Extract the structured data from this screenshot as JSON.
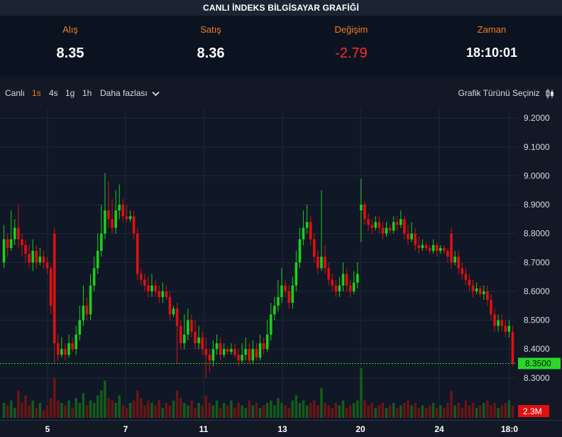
{
  "title": "CANLI İNDEKS BİLGİSAYAR GRAFİĞİ",
  "quotes": {
    "bid": {
      "label": "Alış",
      "value": "8.35"
    },
    "ask": {
      "label": "Satış",
      "value": "8.36"
    },
    "change": {
      "label": "Değişim",
      "value": "-2.79"
    },
    "time": {
      "label": "Zaman",
      "value": "18:10:01"
    }
  },
  "toolbar": {
    "live": "Canlı",
    "intervals": [
      "1s",
      "4s",
      "1g",
      "1h"
    ],
    "active_interval": "1s",
    "more": "Daha fazlası",
    "chart_type": "Grafik Türünü Seçiniz"
  },
  "colors": {
    "up": "#19d219",
    "down": "#e01010",
    "vol_up": "#145c1a",
    "vol_down": "#6a1515",
    "accent": "#f07f1c",
    "last_price": "#2bd62b"
  },
  "chart_data": {
    "type": "candlestick",
    "ylim": [
      8.27,
      9.23
    ],
    "y_ticks": [
      "9.2000",
      "9.1000",
      "9.0000",
      "8.9000",
      "8.8000",
      "8.7000",
      "8.6000",
      "8.5000",
      "8.4000",
      "8.3000"
    ],
    "y_tick_values": [
      9.2,
      9.1,
      9.0,
      8.9,
      8.8,
      8.7,
      8.6,
      8.5,
      8.4,
      8.3
    ],
    "x_ticks": [
      "5",
      "7",
      "11",
      "13",
      "20",
      "24",
      "18:0"
    ],
    "last_price": 8.35,
    "last_price_label": "8.3500",
    "volume_label": "2.3M",
    "candles": [
      [
        8.7,
        8.78,
        8.83,
        8.68
      ],
      [
        8.78,
        8.75,
        8.8,
        8.72
      ],
      [
        8.75,
        8.78,
        8.88,
        8.74
      ],
      [
        8.78,
        8.82,
        8.85,
        8.76
      ],
      [
        8.82,
        8.78,
        8.9,
        8.75
      ],
      [
        8.78,
        8.76,
        8.8,
        8.72
      ],
      [
        8.76,
        8.73,
        8.78,
        8.7
      ],
      [
        8.73,
        8.7,
        8.76,
        8.68
      ],
      [
        8.7,
        8.74,
        8.78,
        8.67
      ],
      [
        8.74,
        8.7,
        8.76,
        8.68
      ],
      [
        8.7,
        8.72,
        8.75,
        8.69
      ],
      [
        8.72,
        8.7,
        8.74,
        8.68
      ],
      [
        8.7,
        8.68,
        8.72,
        8.66
      ],
      [
        8.68,
        8.55,
        8.69,
        8.52
      ],
      [
        8.8,
        8.42,
        8.82,
        8.35
      ],
      [
        8.42,
        8.38,
        8.45,
        8.36
      ],
      [
        8.38,
        8.4,
        8.44,
        8.37
      ],
      [
        8.4,
        8.38,
        8.42,
        8.36
      ],
      [
        8.38,
        8.42,
        8.45,
        8.37
      ],
      [
        8.42,
        8.4,
        8.44,
        8.39
      ],
      [
        8.4,
        8.45,
        8.48,
        8.38
      ],
      [
        8.45,
        8.5,
        8.55,
        8.43
      ],
      [
        8.5,
        8.55,
        8.62,
        8.48
      ],
      [
        8.55,
        8.52,
        8.58,
        8.5
      ],
      [
        8.52,
        8.62,
        8.66,
        8.5
      ],
      [
        8.62,
        8.68,
        8.72,
        8.6
      ],
      [
        8.68,
        8.74,
        8.8,
        8.66
      ],
      [
        8.74,
        8.8,
        8.9,
        8.72
      ],
      [
        8.8,
        8.88,
        9.01,
        8.78
      ],
      [
        8.88,
        8.85,
        8.98,
        8.82
      ],
      [
        8.85,
        8.82,
        8.92,
        8.8
      ],
      [
        8.82,
        8.88,
        8.95,
        8.8
      ],
      [
        8.88,
        8.9,
        8.97,
        8.85
      ],
      [
        8.9,
        8.86,
        8.92,
        8.84
      ],
      [
        8.86,
        8.85,
        8.9,
        8.84
      ],
      [
        8.85,
        8.86,
        8.88,
        8.84
      ],
      [
        8.86,
        8.8,
        8.88,
        8.78
      ],
      [
        8.8,
        8.66,
        8.82,
        8.64
      ],
      [
        8.66,
        8.64,
        8.68,
        8.62
      ],
      [
        8.64,
        8.62,
        8.66,
        8.6
      ],
      [
        8.62,
        8.6,
        8.65,
        8.58
      ],
      [
        8.6,
        8.62,
        8.66,
        8.58
      ],
      [
        8.62,
        8.6,
        8.64,
        8.58
      ],
      [
        8.6,
        8.58,
        8.62,
        8.56
      ],
      [
        8.58,
        8.6,
        8.63,
        8.56
      ],
      [
        8.6,
        8.58,
        8.62,
        8.57
      ],
      [
        8.58,
        8.52,
        8.6,
        8.5
      ],
      [
        8.52,
        8.54,
        8.55,
        8.51
      ],
      [
        8.54,
        8.48,
        8.56,
        8.35
      ],
      [
        8.48,
        8.42,
        8.5,
        8.4
      ],
      [
        8.42,
        8.45,
        8.52,
        8.4
      ],
      [
        8.45,
        8.5,
        8.54,
        8.43
      ],
      [
        8.5,
        8.46,
        8.52,
        8.44
      ],
      [
        8.46,
        8.42,
        8.5,
        8.4
      ],
      [
        8.42,
        8.44,
        8.48,
        8.4
      ],
      [
        8.44,
        8.4,
        8.46,
        8.38
      ],
      [
        8.4,
        8.38,
        8.44,
        8.3
      ],
      [
        8.38,
        8.36,
        8.4,
        8.32
      ],
      [
        8.36,
        8.4,
        8.43,
        8.34
      ],
      [
        8.4,
        8.42,
        8.45,
        8.38
      ],
      [
        8.42,
        8.38,
        8.44,
        8.36
      ],
      [
        8.38,
        8.4,
        8.42,
        8.37
      ],
      [
        8.4,
        8.39,
        8.41,
        8.38
      ],
      [
        8.39,
        8.4,
        8.42,
        8.38
      ],
      [
        8.4,
        8.38,
        8.42,
        8.37
      ],
      [
        8.38,
        8.36,
        8.4,
        8.34
      ],
      [
        8.36,
        8.38,
        8.42,
        8.35
      ],
      [
        8.38,
        8.4,
        8.44,
        8.36
      ],
      [
        8.4,
        8.36,
        8.42,
        8.35
      ],
      [
        8.36,
        8.4,
        8.43,
        8.35
      ],
      [
        8.4,
        8.37,
        8.42,
        8.36
      ],
      [
        8.37,
        8.42,
        8.45,
        8.36
      ],
      [
        8.42,
        8.4,
        8.44,
        8.38
      ],
      [
        8.4,
        8.45,
        8.5,
        8.39
      ],
      [
        8.45,
        8.52,
        8.56,
        8.43
      ],
      [
        8.52,
        8.55,
        8.58,
        8.5
      ],
      [
        8.55,
        8.58,
        8.64,
        8.53
      ],
      [
        8.58,
        8.62,
        8.68,
        8.56
      ],
      [
        8.62,
        8.6,
        8.64,
        8.58
      ],
      [
        8.6,
        8.56,
        8.62,
        8.54
      ],
      [
        8.56,
        8.62,
        8.65,
        8.54
      ],
      [
        8.62,
        8.7,
        8.74,
        8.6
      ],
      [
        8.7,
        8.78,
        8.82,
        8.68
      ],
      [
        8.78,
        8.82,
        8.88,
        8.76
      ],
      [
        8.82,
        8.84,
        8.9,
        8.8
      ],
      [
        8.84,
        8.78,
        8.86,
        8.76
      ],
      [
        8.78,
        8.72,
        8.8,
        8.7
      ],
      [
        8.72,
        8.68,
        8.74,
        8.66
      ],
      [
        8.68,
        8.72,
        8.95,
        8.67
      ],
      [
        8.72,
        8.68,
        8.76,
        8.66
      ],
      [
        8.68,
        8.64,
        8.7,
        8.62
      ],
      [
        8.64,
        8.62,
        8.66,
        8.6
      ],
      [
        8.62,
        8.6,
        8.64,
        8.58
      ],
      [
        8.6,
        8.62,
        8.65,
        8.58
      ],
      [
        8.62,
        8.66,
        8.7,
        8.6
      ],
      [
        8.66,
        8.62,
        8.68,
        8.6
      ],
      [
        8.62,
        8.6,
        8.64,
        8.58
      ],
      [
        8.6,
        8.63,
        8.67,
        8.59
      ],
      [
        8.63,
        8.66,
        8.7,
        8.61
      ],
      [
        8.88,
        8.9,
        8.99,
        8.77
      ],
      [
        8.9,
        8.85,
        8.91,
        8.83
      ],
      [
        8.85,
        8.83,
        8.87,
        8.81
      ],
      [
        8.83,
        8.82,
        8.85,
        8.8
      ],
      [
        8.82,
        8.84,
        8.86,
        8.81
      ],
      [
        8.84,
        8.82,
        8.86,
        8.8
      ],
      [
        8.82,
        8.8,
        8.84,
        8.78
      ],
      [
        8.8,
        8.82,
        8.84,
        8.79
      ],
      [
        8.82,
        8.81,
        8.83,
        8.8
      ],
      [
        8.81,
        8.84,
        8.86,
        8.8
      ],
      [
        8.84,
        8.83,
        8.86,
        8.81
      ],
      [
        8.83,
        8.85,
        8.88,
        8.82
      ],
      [
        8.85,
        8.8,
        8.86,
        8.78
      ],
      [
        8.8,
        8.78,
        8.83,
        8.76
      ],
      [
        8.78,
        8.8,
        8.84,
        8.77
      ],
      [
        8.8,
        8.76,
        8.82,
        8.74
      ],
      [
        8.76,
        8.75,
        8.79,
        8.73
      ],
      [
        8.75,
        8.76,
        8.78,
        8.74
      ],
      [
        8.76,
        8.75,
        8.77,
        8.74
      ],
      [
        8.75,
        8.74,
        8.76,
        8.73
      ],
      [
        8.74,
        8.76,
        8.78,
        8.73
      ],
      [
        8.76,
        8.74,
        8.77,
        8.72
      ],
      [
        8.74,
        8.75,
        8.76,
        8.73
      ],
      [
        8.75,
        8.74,
        8.76,
        8.73
      ],
      [
        8.74,
        8.72,
        8.75,
        8.7
      ],
      [
        8.8,
        8.7,
        8.82,
        8.68
      ],
      [
        8.7,
        8.72,
        8.74,
        8.69
      ],
      [
        8.72,
        8.68,
        8.74,
        8.66
      ],
      [
        8.68,
        8.66,
        8.7,
        8.64
      ],
      [
        8.66,
        8.64,
        8.68,
        8.62
      ],
      [
        8.64,
        8.62,
        8.66,
        8.6
      ],
      [
        8.62,
        8.6,
        8.64,
        8.58
      ],
      [
        8.6,
        8.61,
        8.63,
        8.59
      ],
      [
        8.61,
        8.59,
        8.62,
        8.58
      ],
      [
        8.59,
        8.6,
        8.62,
        8.57
      ],
      [
        8.6,
        8.57,
        8.62,
        8.55
      ],
      [
        8.57,
        8.52,
        8.59,
        8.5
      ],
      [
        8.52,
        8.48,
        8.54,
        8.46
      ],
      [
        8.48,
        8.5,
        8.52,
        8.46
      ],
      [
        8.5,
        8.48,
        8.52,
        8.46
      ],
      [
        8.48,
        8.46,
        8.5,
        8.44
      ],
      [
        8.46,
        8.48,
        8.5,
        8.44
      ],
      [
        8.46,
        8.35,
        8.48,
        8.34
      ]
    ],
    "volumes": [
      0.3,
      0.25,
      0.35,
      0.2,
      0.55,
      0.3,
      0.45,
      0.25,
      0.35,
      0.2,
      0.3,
      0.15,
      0.25,
      0.4,
      0.8,
      0.35,
      0.3,
      0.25,
      0.35,
      0.2,
      0.4,
      0.3,
      0.5,
      0.25,
      0.35,
      0.3,
      0.45,
      0.55,
      0.75,
      0.4,
      0.35,
      0.3,
      0.45,
      0.25,
      0.2,
      0.3,
      0.35,
      0.55,
      0.4,
      0.25,
      0.35,
      0.3,
      0.25,
      0.35,
      0.2,
      0.3,
      0.25,
      0.35,
      0.55,
      0.4,
      0.3,
      0.25,
      0.35,
      0.2,
      0.3,
      0.25,
      0.45,
      0.3,
      0.25,
      0.35,
      0.2,
      0.3,
      0.25,
      0.35,
      0.2,
      0.3,
      0.25,
      0.2,
      0.35,
      0.25,
      0.3,
      0.2,
      0.25,
      0.3,
      0.35,
      0.25,
      0.4,
      0.3,
      0.25,
      0.2,
      0.35,
      0.45,
      0.3,
      0.35,
      0.25,
      0.3,
      0.35,
      0.25,
      0.6,
      0.3,
      0.25,
      0.2,
      0.3,
      0.25,
      0.35,
      0.2,
      0.25,
      0.3,
      0.35,
      1.0,
      0.35,
      0.25,
      0.3,
      0.2,
      0.25,
      0.3,
      0.2,
      0.25,
      0.3,
      0.2,
      0.25,
      0.3,
      0.35,
      0.25,
      0.3,
      0.2,
      0.25,
      0.2,
      0.25,
      0.3,
      0.2,
      0.25,
      0.2,
      0.3,
      0.55,
      0.25,
      0.3,
      0.2,
      0.35,
      0.25,
      0.3,
      0.2,
      0.25,
      0.3,
      0.35,
      0.25,
      0.3,
      0.2,
      0.25,
      0.3,
      0.35,
      0.25
    ]
  }
}
